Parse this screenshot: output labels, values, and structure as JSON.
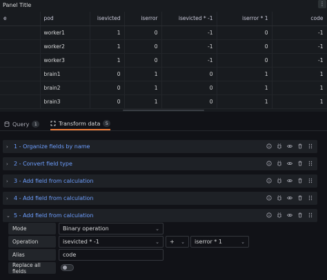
{
  "panel": {
    "title": "Panel Title",
    "menu_glyph": "⋮"
  },
  "table": {
    "columns": [
      "e",
      "pod",
      "isevicted",
      "iserror",
      "isevicted * -1",
      "iserror * 1",
      "code"
    ],
    "rows": [
      [
        "",
        "worker1",
        "1",
        "0",
        "-1",
        "0",
        "-1"
      ],
      [
        "",
        "worker2",
        "1",
        "0",
        "-1",
        "0",
        "-1"
      ],
      [
        "",
        "worker3",
        "1",
        "0",
        "-1",
        "0",
        "-1"
      ],
      [
        "",
        "brain1",
        "0",
        "1",
        "0",
        "1",
        "1"
      ],
      [
        "",
        "brain2",
        "0",
        "1",
        "0",
        "1",
        "1"
      ],
      [
        "",
        "brain3",
        "0",
        "1",
        "0",
        "1",
        "1"
      ]
    ]
  },
  "tabs": [
    {
      "label": "Query",
      "count": "1",
      "active": false
    },
    {
      "label": "Transform data",
      "count": "5",
      "active": true
    }
  ],
  "transforms": [
    {
      "title": "1 - Organize fields by name",
      "expanded": false
    },
    {
      "title": "2 - Convert field type",
      "expanded": false
    },
    {
      "title": "3 - Add field from calculation",
      "expanded": false
    },
    {
      "title": "4 - Add field from calculation",
      "expanded": false
    },
    {
      "title": "5 - Add field from calculation",
      "expanded": true
    }
  ],
  "editor": {
    "mode_label": "Mode",
    "mode_value": "Binary operation",
    "operation_label": "Operation",
    "operation_left": "isevicted * -1",
    "operation_operator": "+",
    "operation_right": "iserror * 1",
    "alias_label": "Alias",
    "alias_value": "code",
    "replace_label": "Replace all fields",
    "replace_on": false
  },
  "colors": {
    "accent": "#f57e38",
    "link": "#6e9fff",
    "background": "#111217"
  }
}
